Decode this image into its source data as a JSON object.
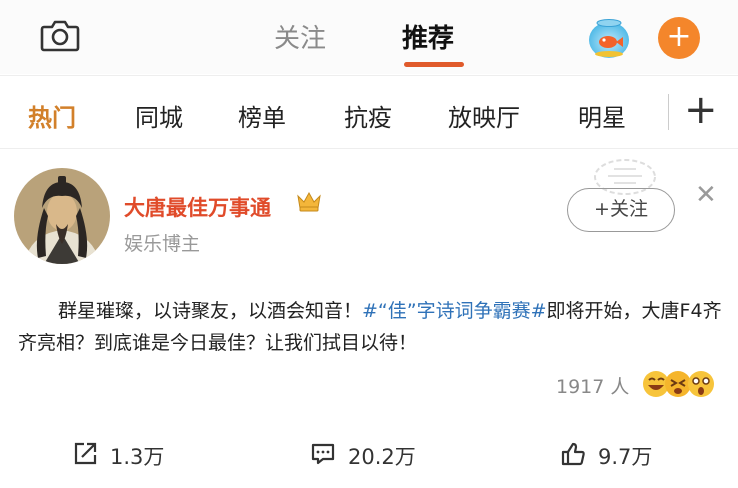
{
  "header": {
    "tabs": [
      {
        "label": "关注",
        "active": false
      },
      {
        "label": "推荐",
        "active": true
      }
    ],
    "icons": [
      "camera-icon",
      "fishbowl-icon",
      "plus-icon"
    ],
    "accent_color": "#e05a2b"
  },
  "channels": {
    "items": [
      "热门",
      "同城",
      "榜单",
      "抗疫",
      "放映厅",
      "明星"
    ],
    "active_index": 0,
    "add_label": "+"
  },
  "post": {
    "author": {
      "name": "大唐最佳万事通",
      "tag": "娱乐博主",
      "name_color": "#e04b2a"
    },
    "follow_label": "+关注",
    "text_before": "群星璀璨，以诗聚友，以酒会知音！",
    "hashtag": "#“佳”字诗词争霸赛#",
    "text_after": "即将开始，大唐F4齐齐亮相？到底谁是今日最佳？让我们拭目以待！",
    "hashtag_color": "#2f72b8",
    "viewers": "1917 人",
    "actions": {
      "share": "1.3万",
      "comment": "20.2万",
      "like": "9.7万"
    }
  }
}
